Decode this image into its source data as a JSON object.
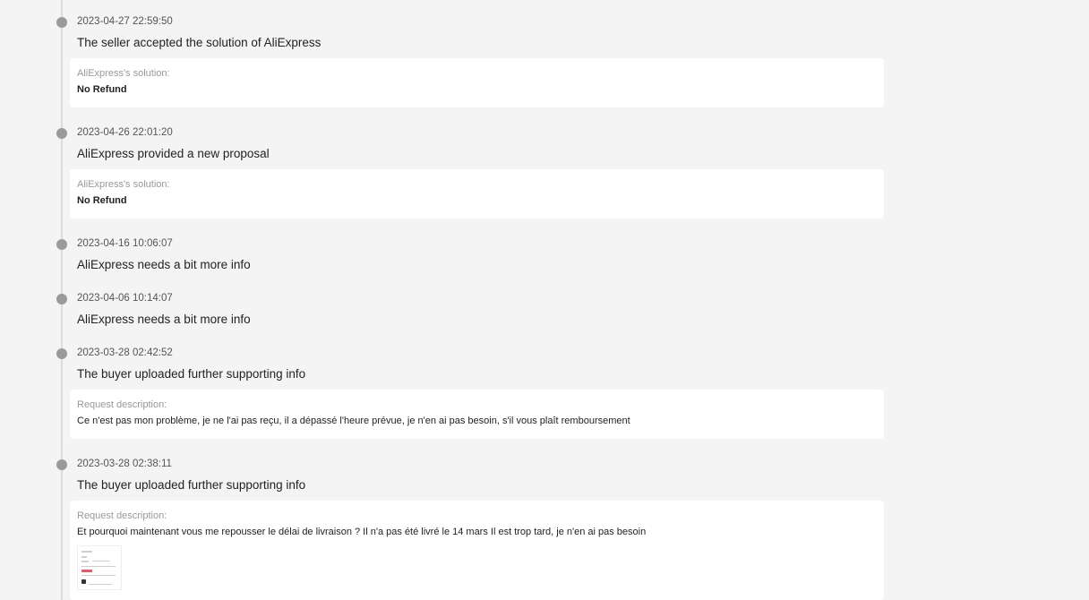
{
  "timeline": {
    "events": [
      {
        "timestamp": "2023-04-27 22:59:50",
        "title": "The seller accepted the solution of AliExpress",
        "card": {
          "label": "AliExpress's solution:",
          "value": "No Refund"
        }
      },
      {
        "timestamp": "2023-04-26 22:01:20",
        "title": "AliExpress provided a new proposal",
        "card": {
          "label": "AliExpress's solution:",
          "value": "No Refund"
        }
      },
      {
        "timestamp": "2023-04-16 10:06:07",
        "title": "AliExpress needs a bit more info"
      },
      {
        "timestamp": "2023-04-06 10:14:07",
        "title": "AliExpress needs a bit more info"
      },
      {
        "timestamp": "2023-03-28 02:42:52",
        "title": "The buyer uploaded further supporting info",
        "card": {
          "label": "Request description:",
          "value": "Ce n'est pas mon problème, je ne l'ai pas reçu, il a dépassé l'heure prévue, je n'en ai pas besoin, s'il vous plaît remboursement"
        }
      },
      {
        "timestamp": "2023-03-28 02:38:11",
        "title": "The buyer uploaded further supporting info",
        "card": {
          "label": "Request description:",
          "value": "Et pourquoi maintenant vous me repousser le délai de livraison ? Il n'a pas été livré le 14 mars Il est trop tard, je n'en ai pas besoin",
          "attachment": "screenshot-thumbnail"
        }
      }
    ]
  },
  "colors": {
    "background": "#f4f4f4",
    "card": "#ffffff",
    "dot": "#9a9a9a",
    "line": "#dcdcdc",
    "muted_text": "#999999"
  }
}
